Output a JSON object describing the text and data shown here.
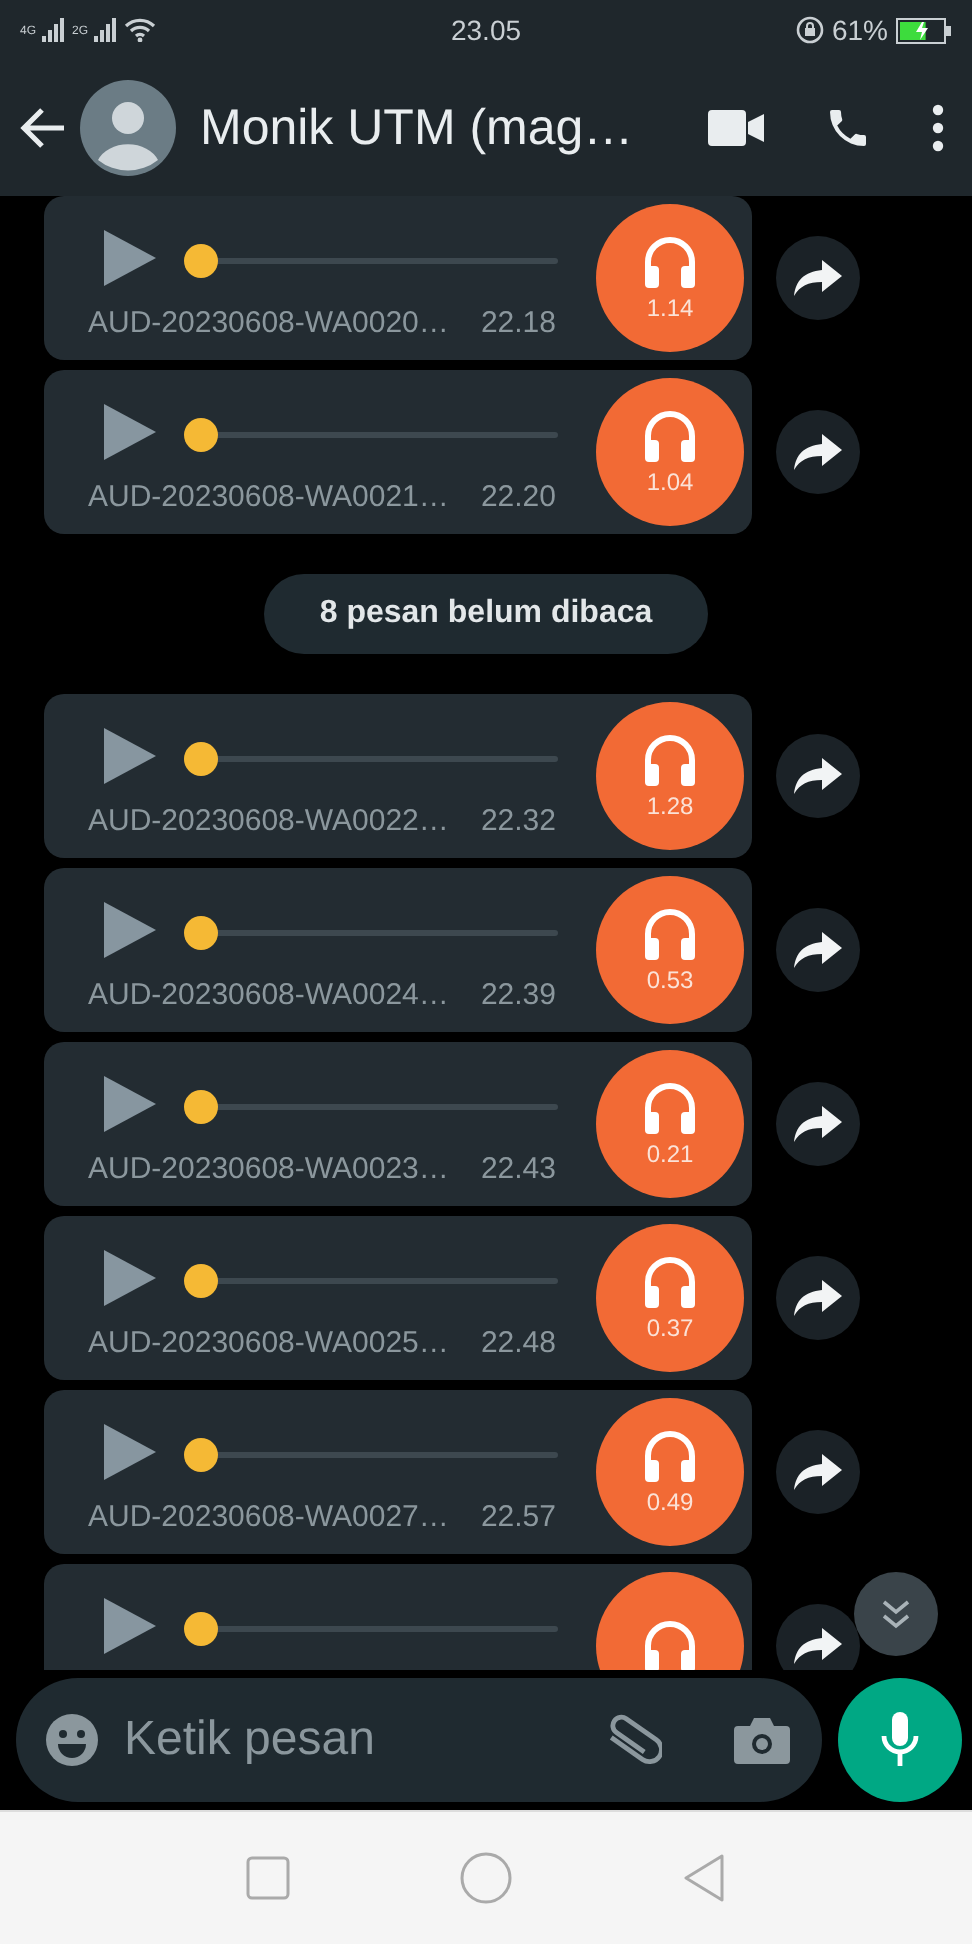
{
  "status_bar": {
    "network_1": "4G",
    "network_2": "2G",
    "time": "23.05",
    "battery": "61%",
    "charging": true
  },
  "header": {
    "title": "Monik UTM (mag…"
  },
  "items": [
    {
      "kind": "audio",
      "file": "AUD-20230608-WA0020…",
      "time": "22.18",
      "duration": "1.14",
      "level": 0
    },
    {
      "kind": "audio",
      "file": "AUD-20230608-WA0021…",
      "time": "22.20",
      "duration": "1.04",
      "level": 0
    },
    {
      "kind": "banner",
      "text": "8 pesan belum dibaca"
    },
    {
      "kind": "audio",
      "file": "AUD-20230608-WA0022…",
      "time": "22.32",
      "duration": "1.28",
      "level": 0
    },
    {
      "kind": "audio",
      "file": "AUD-20230608-WA0024…",
      "time": "22.39",
      "duration": "0.53",
      "level": 0
    },
    {
      "kind": "audio",
      "file": "AUD-20230608-WA0023…",
      "time": "22.43",
      "duration": "0.21",
      "level": 0
    },
    {
      "kind": "audio",
      "file": "AUD-20230608-WA0025…",
      "time": "22.48",
      "duration": "0.37",
      "level": 0
    },
    {
      "kind": "audio",
      "file": "AUD-20230608-WA0027…",
      "time": "22.57",
      "duration": "0.49",
      "level": 0
    },
    {
      "kind": "audio",
      "level": 0
    }
  ],
  "composer": {
    "placeholder": "Ketik pesan"
  }
}
